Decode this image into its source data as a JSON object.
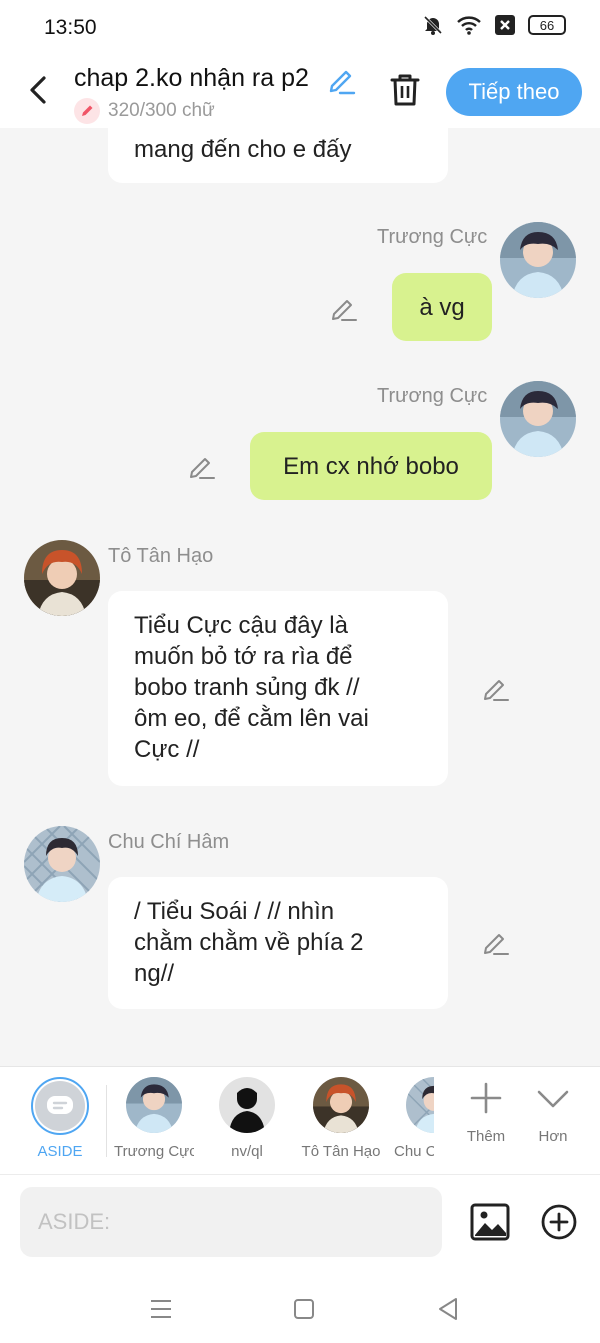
{
  "status": {
    "time": "13:50",
    "battery": "66"
  },
  "header": {
    "title": "chap 2.ko nhận ra p2",
    "word_count": "320/300 chữ",
    "next_button": "Tiếp theo"
  },
  "messages": [
    {
      "type": "partial",
      "text": "mang đến cho e đấy"
    },
    {
      "sender": "Trương Cực",
      "text": "à vg",
      "side": "right"
    },
    {
      "sender": "Trương Cực",
      "text": "Em cx nhớ bobo",
      "side": "right"
    },
    {
      "sender": "Tô Tân Hạo",
      "lines": [
        "Tiểu Cực cậu đây là",
        "muốn bỏ tớ ra rìa để",
        "bobo tranh sủng đk //",
        "ôm eo, để cằm lên vai",
        "Cực //"
      ],
      "side": "left"
    },
    {
      "sender": "Chu Chí Hâm",
      "lines": [
        "/ Tiểu Soái / // nhìn",
        "chằm chằm về phía 2",
        "ng//"
      ],
      "side": "left"
    }
  ],
  "characters": [
    {
      "label": "ASIDE",
      "active": true
    },
    {
      "label": "Trương Cực"
    },
    {
      "label": "nv/ql"
    },
    {
      "label": "Tô Tân Hạo"
    },
    {
      "label": "Chu C"
    }
  ],
  "tools": {
    "add_label": "Thêm",
    "more_label": "Hơn"
  },
  "input": {
    "placeholder": "ASIDE:"
  },
  "colors": {
    "accent": "#4fa6f2",
    "own_bubble": "#d8f28f",
    "other_bubble": "#ffffff"
  }
}
